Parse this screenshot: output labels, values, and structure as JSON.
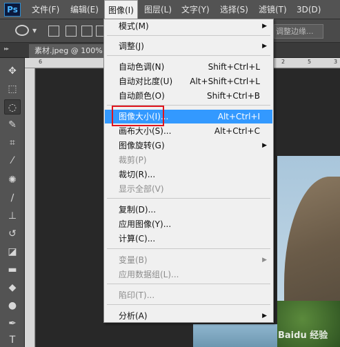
{
  "app": {
    "logo": "Ps"
  },
  "menubar": [
    {
      "label": "文件(F)"
    },
    {
      "label": "编辑(E)"
    },
    {
      "label": "图像(I)"
    },
    {
      "label": "图层(L)"
    },
    {
      "label": "文字(Y)"
    },
    {
      "label": "选择(S)"
    },
    {
      "label": "滤镜(T)"
    },
    {
      "label": "3D(D)"
    }
  ],
  "options": {
    "refine_edge_label": "调整边缘..."
  },
  "document_tab": {
    "label": "素材.jpeg @ 100%"
  },
  "ruler": {
    "top_ticks": [
      "6",
      "1",
      "5",
      "2",
      "5",
      "3"
    ]
  },
  "watermark": {
    "text": "Baidu 经验"
  },
  "image_menu": {
    "items": [
      {
        "label": "模式(M)",
        "shortcut": "",
        "submenu": true,
        "disabled": false
      },
      {
        "label": "调整(J)",
        "shortcut": "",
        "submenu": true,
        "disabled": false
      },
      {
        "label": "自动色调(N)",
        "shortcut": "Shift+Ctrl+L",
        "submenu": false,
        "disabled": false
      },
      {
        "label": "自动对比度(U)",
        "shortcut": "Alt+Shift+Ctrl+L",
        "submenu": false,
        "disabled": false
      },
      {
        "label": "自动颜色(O)",
        "shortcut": "Shift+Ctrl+B",
        "submenu": false,
        "disabled": false
      },
      {
        "label": "图像大小(I)...",
        "shortcut": "Alt+Ctrl+I",
        "submenu": false,
        "disabled": false
      },
      {
        "label": "画布大小(S)...",
        "shortcut": "Alt+Ctrl+C",
        "submenu": false,
        "disabled": false
      },
      {
        "label": "图像旋转(G)",
        "shortcut": "",
        "submenu": true,
        "disabled": false
      },
      {
        "label": "裁剪(P)",
        "shortcut": "",
        "submenu": false,
        "disabled": true
      },
      {
        "label": "裁切(R)...",
        "shortcut": "",
        "submenu": false,
        "disabled": false
      },
      {
        "label": "显示全部(V)",
        "shortcut": "",
        "submenu": false,
        "disabled": true
      },
      {
        "label": "复制(D)...",
        "shortcut": "",
        "submenu": false,
        "disabled": false
      },
      {
        "label": "应用图像(Y)...",
        "shortcut": "",
        "submenu": false,
        "disabled": false
      },
      {
        "label": "计算(C)...",
        "shortcut": "",
        "submenu": false,
        "disabled": false
      },
      {
        "label": "变量(B)",
        "shortcut": "",
        "submenu": true,
        "disabled": true
      },
      {
        "label": "应用数据组(L)...",
        "shortcut": "",
        "submenu": false,
        "disabled": true
      },
      {
        "label": "陷印(T)...",
        "shortcut": "",
        "submenu": false,
        "disabled": true
      },
      {
        "label": "分析(A)",
        "shortcut": "",
        "submenu": true,
        "disabled": false
      }
    ],
    "highlighted": "图像大小(I)..."
  }
}
